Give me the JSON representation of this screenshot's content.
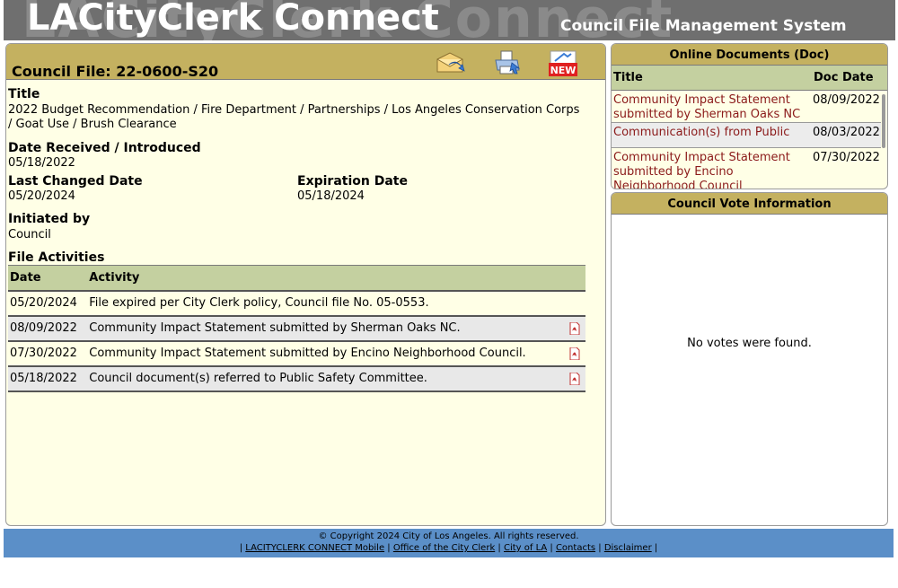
{
  "header": {
    "logo": "LACityClerk Connect",
    "ghost": "LACityClerk Connect",
    "subtitle": "Council File Management System"
  },
  "file": {
    "title": "Council File: 22-0600-S20",
    "title_label": "Title",
    "title_value": "2022 Budget Recommendation / Fire Department / Partnerships / Los Angeles Conservation Corps / Goat Use / Brush Clearance",
    "date_received_label": "Date Received / Introduced",
    "date_received_value": "05/18/2022",
    "last_changed_label": "Last Changed Date",
    "last_changed_value": "05/20/2024",
    "expiration_label": "Expiration Date",
    "expiration_value": "05/18/2024",
    "initiated_label": "Initiated by",
    "initiated_value": "Council",
    "activities_label": "File Activities"
  },
  "toolbar": {
    "new_badge": "NEW"
  },
  "activities": {
    "col_date": "Date",
    "col_activity": "Activity",
    "rows": [
      {
        "date": "05/20/2024",
        "activity": "File expired per City Clerk policy, Council file No. 05-0553."
      },
      {
        "date": "08/09/2022",
        "activity": "Community Impact Statement submitted by Sherman Oaks NC."
      },
      {
        "date": "07/30/2022",
        "activity": "Community Impact Statement submitted by Encino Neighborhood Council."
      },
      {
        "date": "05/18/2022",
        "activity": "Council document(s) referred to Public Safety Committee."
      }
    ]
  },
  "docs": {
    "heading": "Online Documents (Doc)",
    "col_title": "Title",
    "col_date": "Doc Date",
    "rows": [
      {
        "title": "Community Impact Statement submitted by Sherman Oaks NC",
        "date": "08/09/2022"
      },
      {
        "title": "Communication(s) from Public",
        "date": "08/03/2022"
      },
      {
        "title": "Community Impact Statement submitted by Encino Neighborhood Council",
        "date": "07/30/2022"
      }
    ]
  },
  "votes": {
    "heading": "Council Vote Information",
    "empty": "No votes were found."
  },
  "footer": {
    "copyright": "© Copyright 2024 City of Los Angeles. All rights reserved.",
    "links": [
      "LACITYCLERK CONNECT Mobile",
      "Office of the City Clerk",
      "City of LA",
      "Contacts",
      "Disclaimer"
    ]
  },
  "colors": {
    "header_bg": "#6f6f6f",
    "panel_head": "#c4b160",
    "table_head": "#c4d0a0",
    "panel_bg": "#ffffe6",
    "link_red": "#8b1a1a",
    "footer_bg": "#5b8fc8"
  },
  "icons": [
    "email-icon",
    "print-icon",
    "new-icon",
    "pdf-icon"
  ]
}
